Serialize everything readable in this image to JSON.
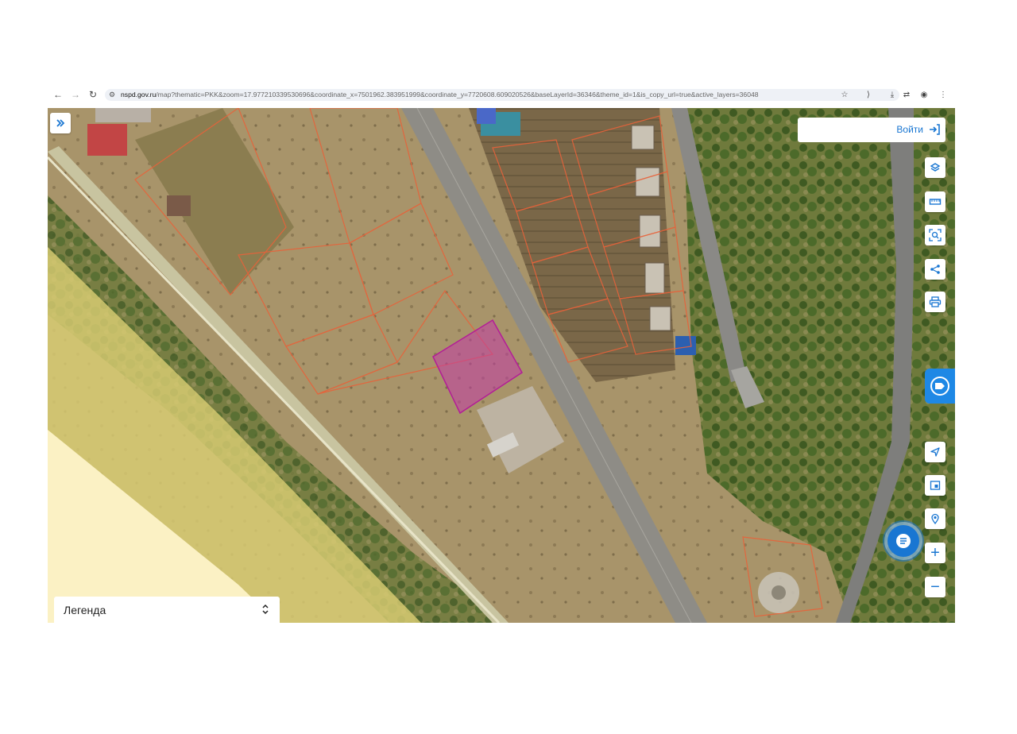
{
  "browser": {
    "back_icon": "arrow-left-icon",
    "forward_icon": "arrow-right-icon",
    "reload_icon": "reload-icon",
    "url_host": "nspd.gov.ru",
    "url_path": "/map?thematic=PKK&zoom=17.977210339530696&coordinate_x=7501962.383951999&coordinate_y=7720608.609020526&baseLayerId=36346&theme_id=1&is_copy_url=true&active_layers=36048",
    "actions": [
      "star-icon",
      "extensions-icon",
      "download-icon",
      "translate-icon",
      "profile-icon",
      "menu-icon"
    ]
  },
  "map": {
    "expand_icon": "double-chevron-right-icon",
    "login_label": "Войти",
    "login_icon": "login-icon",
    "tools": [
      "layers-icon",
      "ruler-icon",
      "search-area-icon",
      "share-icon",
      "print-icon"
    ],
    "assistant_icon": "assistant-logo-icon",
    "nav_tools": [
      "locate-arrow-icon",
      "minimap-icon",
      "geolocation-icon"
    ],
    "zoom_in": "+",
    "zoom_out": "−",
    "chat_icon": "chat-icon",
    "legend_title": "Легенда",
    "legend_toggle_icon": "chevron-updown-icon",
    "accent_color": "#1976d2",
    "selected_parcel_color": "#c23aa5",
    "parcel_border_color": "#e8623a"
  }
}
